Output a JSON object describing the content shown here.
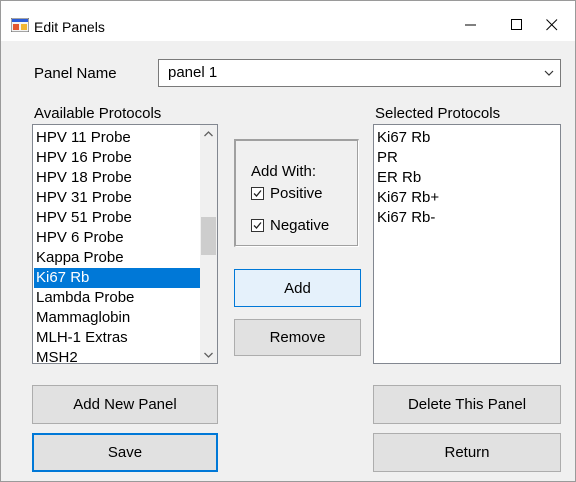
{
  "window": {
    "title": "Edit Panels",
    "minimize_glyph": "—",
    "maximize_glyph": "☐",
    "close_glyph": "✕"
  },
  "panel_name": {
    "label": "Panel Name",
    "value": "panel 1"
  },
  "available": {
    "label": "Available Protocols",
    "items": [
      "HPV 11 Probe",
      "HPV 16 Probe",
      "HPV 18 Probe",
      "HPV 31 Probe",
      "HPV 51 Probe",
      "HPV 6 Probe",
      "Kappa Probe",
      "Ki67 Rb",
      "Lambda Probe",
      "Mammaglobin",
      "MLH-1 Extras",
      "MSH2"
    ],
    "selected_index": 7
  },
  "selected": {
    "label": "Selected Protocols",
    "items": [
      "Ki67 Rb",
      "PR",
      "ER Rb",
      "Ki67 Rb+",
      "Ki67 Rb-"
    ]
  },
  "add_with": {
    "label": "Add With:",
    "positive": {
      "label": "Positive",
      "checked": true
    },
    "negative": {
      "label": "Negative",
      "checked": true
    }
  },
  "buttons": {
    "add": "Add",
    "remove": "Remove",
    "add_new_panel": "Add New Panel",
    "delete_panel": "Delete This Panel",
    "save": "Save",
    "return": "Return"
  },
  "colors": {
    "selection": "#0078d7",
    "window_bg": "#f0f0f0"
  }
}
